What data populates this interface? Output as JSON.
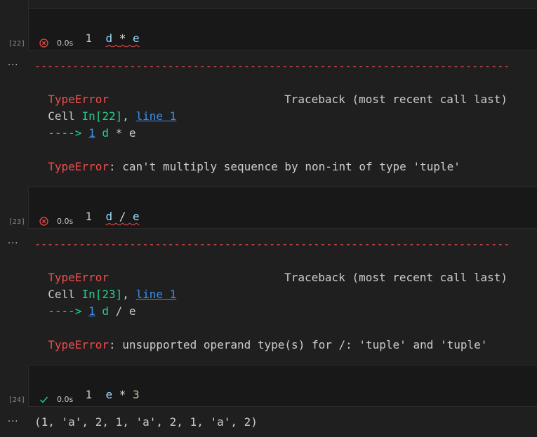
{
  "cells": [
    {
      "exec_count": "[22]",
      "code": {
        "lineno": "1",
        "a": "d",
        "op": "*",
        "b": "e"
      },
      "status": {
        "time": "0.0s",
        "icon": "error-circle-icon"
      },
      "output_ellipsis": "...",
      "error": {
        "dashes": "---------------------------------------------------------------------------",
        "type": "TypeError",
        "traceback_label": "Traceback (most recent call last)",
        "cell_prefix": "Cell ",
        "cell_ref": "In[22]",
        "comma": ", ",
        "line_link": "line 1",
        "arrow": "---->",
        "arrow_lineno": "1",
        "arrow_a": "d",
        "arrow_op": "*",
        "arrow_b": "e",
        "message": ": can't multiply sequence by non-int of type 'tuple'"
      }
    },
    {
      "exec_count": "[23]",
      "code": {
        "lineno": "1",
        "a": "d",
        "op": "/",
        "b": "e"
      },
      "status": {
        "time": "0.0s",
        "icon": "error-circle-icon"
      },
      "output_ellipsis": "...",
      "error": {
        "dashes": "---------------------------------------------------------------------------",
        "type": "TypeError",
        "traceback_label": "Traceback (most recent call last)",
        "cell_prefix": "Cell ",
        "cell_ref": "In[23]",
        "comma": ", ",
        "line_link": "line 1",
        "arrow": "---->",
        "arrow_lineno": "1",
        "arrow_a": "d",
        "arrow_op": "/",
        "arrow_b": "e",
        "message": ": unsupported operand type(s) for /: 'tuple' and 'tuple'"
      }
    },
    {
      "exec_count": "[24]",
      "code": {
        "lineno": "1",
        "a": "e",
        "op": "*",
        "b": "3"
      },
      "status": {
        "time": "0.0s",
        "icon": "check-icon"
      },
      "output_ellipsis": "...",
      "result": "(1, 'a', 2, 1, 'a', 2, 1, 'a', 2)"
    }
  ],
  "colors": {
    "error": "#f14c4c",
    "success": "#23d18b",
    "link": "#3b8eea",
    "variable": "#9cdcfe"
  }
}
